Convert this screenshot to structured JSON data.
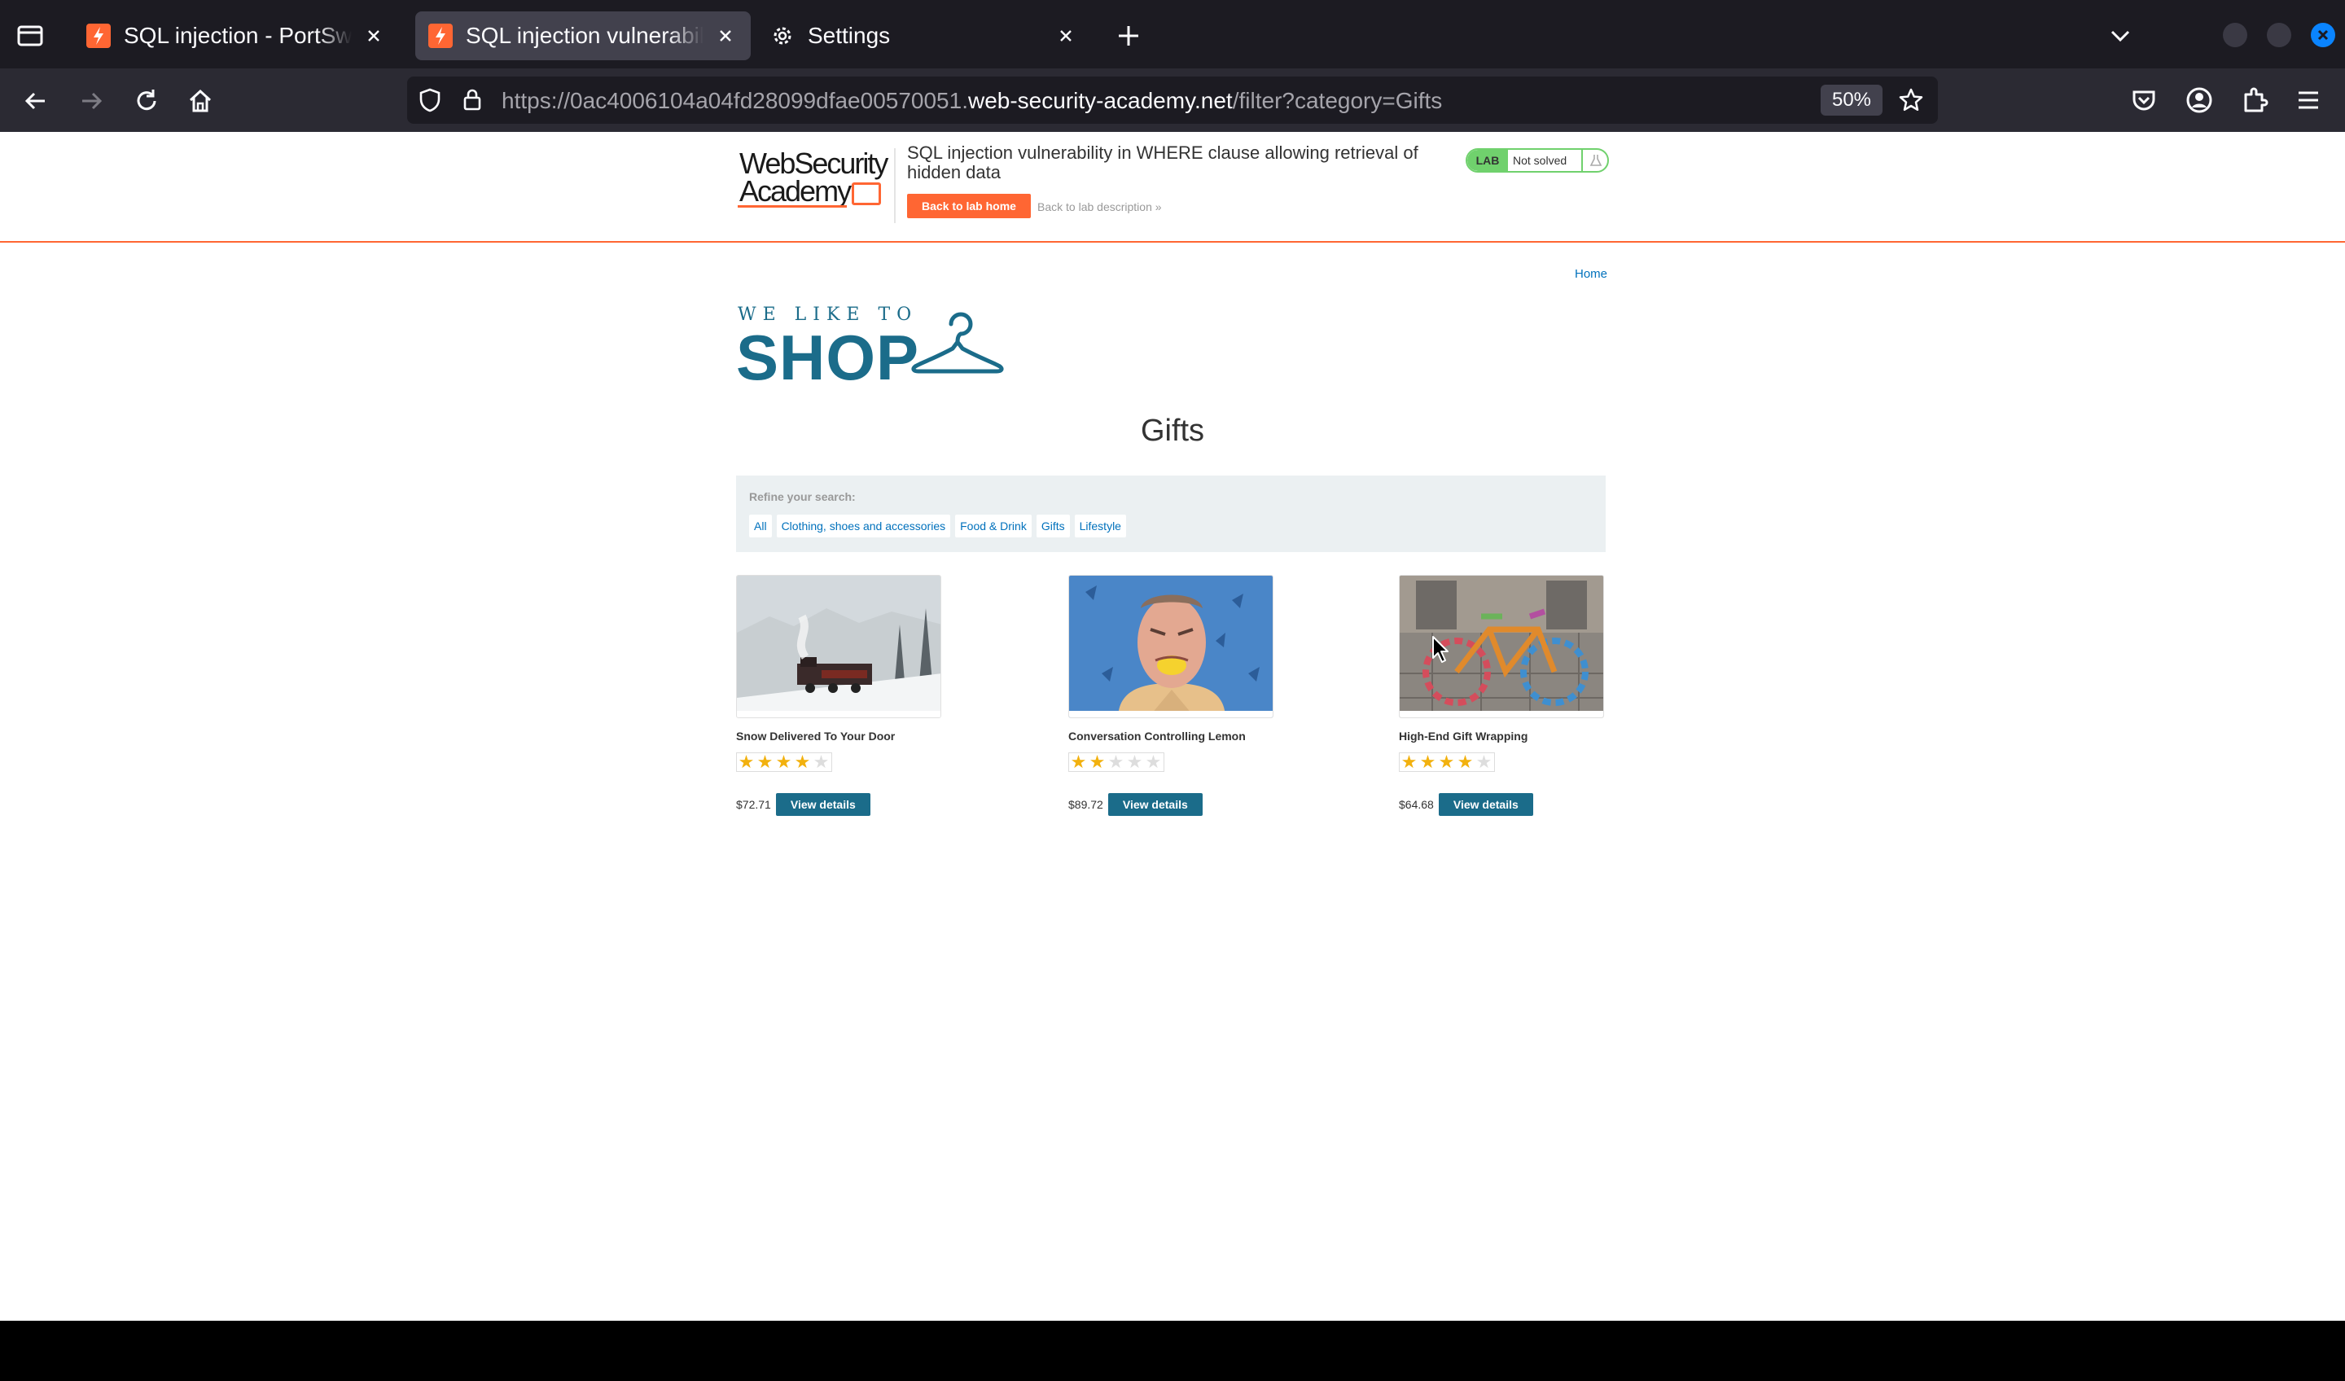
{
  "browser": {
    "tabs": [
      {
        "title": "SQL injection - PortSwigg",
        "active": false
      },
      {
        "title": "SQL injection vulnerability",
        "active": true
      },
      {
        "title": "Settings",
        "active": false
      }
    ],
    "url": {
      "scheme": "https://",
      "subdomain": "0ac4006104a04fd28099dfae00570051.",
      "host": "web-security-academy.net",
      "path": "/filter?category=Gifts"
    },
    "zoom": "50%",
    "colors": {
      "accent": "#0a84ff",
      "tab_active": "#42414d",
      "frame": "#1c1b22"
    }
  },
  "lab_header": {
    "logo_line1": "WebSecurity",
    "logo_line2": "Academy",
    "title": "SQL injection vulnerability in WHERE clause allowing retrieval of hidden data",
    "back_home": "Back to lab home",
    "back_desc": "Back to lab description",
    "back_desc_arrow": "»",
    "lab_badge": "LAB",
    "status": "Not solved",
    "colors": {
      "accent": "#ff6633",
      "status": "#70d16d"
    }
  },
  "shop": {
    "home_link": "Home",
    "logo_small": "WE LIKE TO",
    "logo_big": "SHOP",
    "page_title": "Gifts",
    "refine_label": "Refine your search:",
    "filters": [
      "All",
      "Clothing, shoes and accessories",
      "Food & Drink",
      "Gifts",
      "Lifestyle"
    ],
    "products": [
      {
        "name": "Snow Delivered To Your Door",
        "rating": 4,
        "price": "$72.71",
        "button": "View details"
      },
      {
        "name": "Conversation Controlling Lemon",
        "rating": 2,
        "price": "$89.72",
        "button": "View details"
      },
      {
        "name": "High-End Gift Wrapping",
        "rating": 4,
        "price": "$64.68",
        "button": "View details"
      }
    ],
    "colors": {
      "brand": "#1b6c8a",
      "link": "#0071bc",
      "star": "#f2b10e"
    }
  }
}
